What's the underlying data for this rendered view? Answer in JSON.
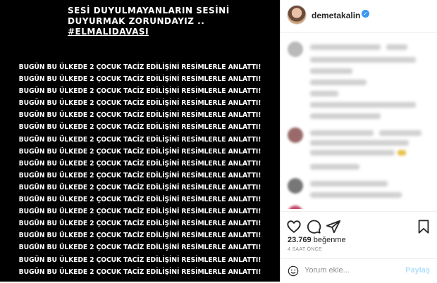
{
  "post_image": {
    "caption_lines": [
      "SESİ DUYULMAYANLARIN SESİNİ",
      "DUYURMAK ZORUNDAYIZ ..",
      "#ELMALIDAVASI"
    ],
    "repeated_line": "BUGÜN BU ÜLKEDE 2 ÇOCUK TACİZ EDİLİŞİNİ RESİMLERLE ANLATTI!",
    "repeat_count": 18
  },
  "header": {
    "username": "demetakalin",
    "verified_mark": "✓"
  },
  "actions": {
    "likes_count": "23.769",
    "likes_label": "beğenme",
    "time": "4 SAAT ÖNCE"
  },
  "comment_box": {
    "placeholder": "Yorum ekle...",
    "share_label": "Paylaş"
  }
}
